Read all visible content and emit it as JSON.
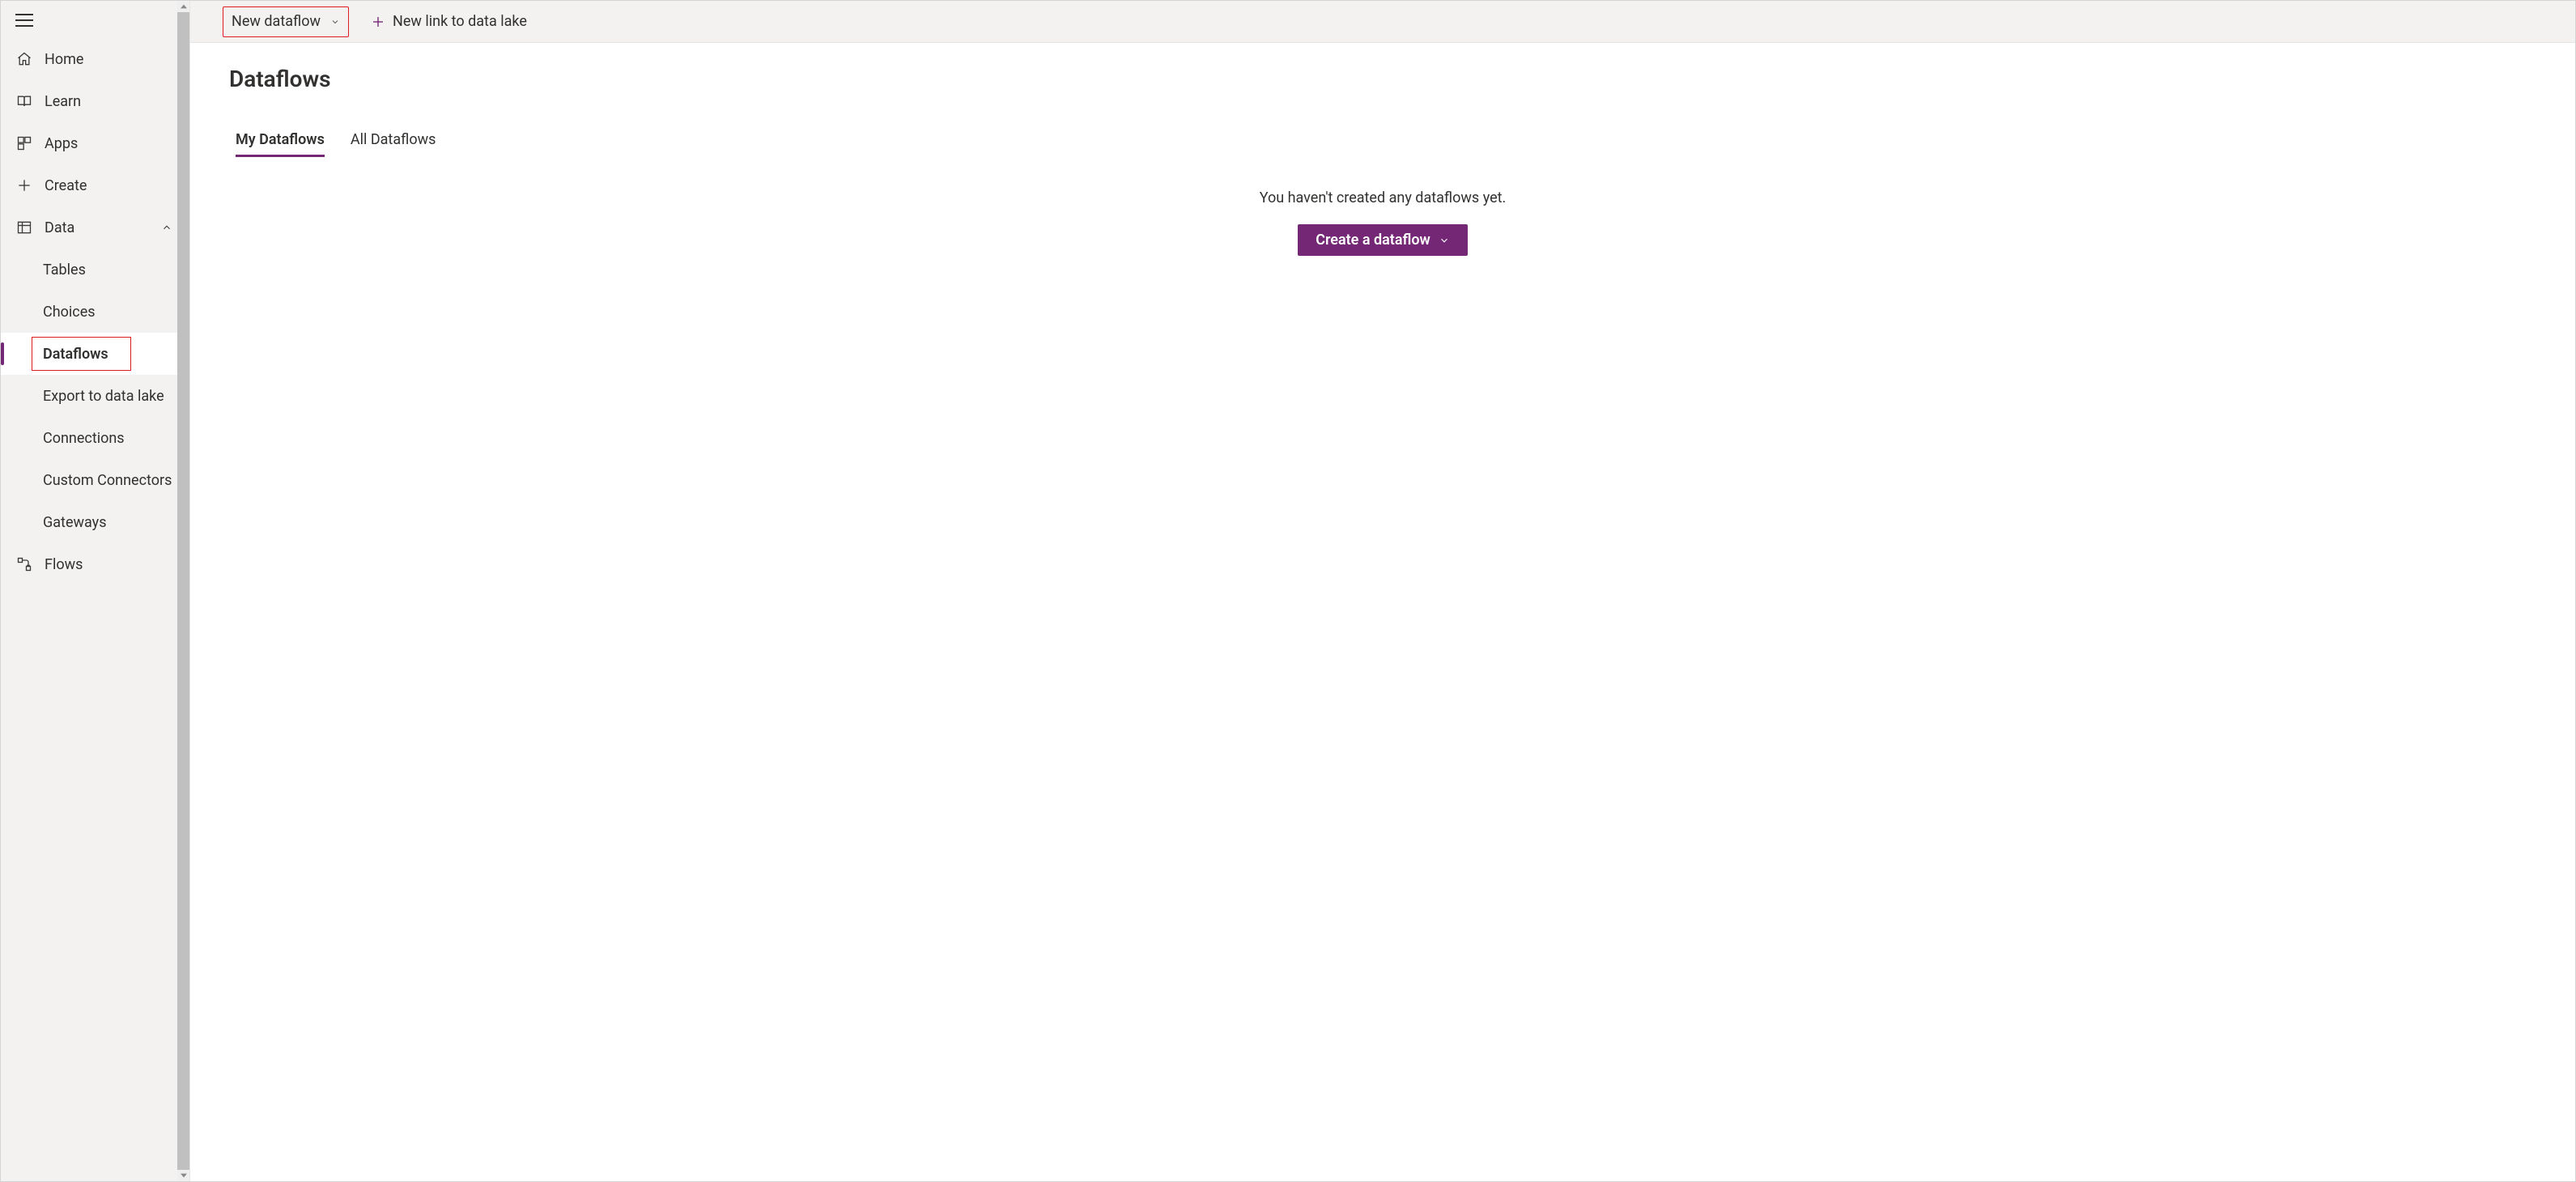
{
  "colors": {
    "accent": "#742774",
    "highlight_border": "#e11b22",
    "sidebar_bg": "#f3f2f1"
  },
  "sidebar": {
    "items": [
      {
        "icon": "home-icon",
        "label": "Home",
        "active": false
      },
      {
        "icon": "learn-icon",
        "label": "Learn",
        "active": false
      },
      {
        "icon": "apps-icon",
        "label": "Apps",
        "active": false
      },
      {
        "icon": "create-icon",
        "label": "Create",
        "active": false
      },
      {
        "icon": "data-icon",
        "label": "Data",
        "active": false,
        "expanded": true,
        "children": [
          {
            "label": "Tables",
            "active": false
          },
          {
            "label": "Choices",
            "active": false
          },
          {
            "label": "Dataflows",
            "active": true,
            "highlighted": true
          },
          {
            "label": "Export to data lake",
            "active": false
          },
          {
            "label": "Connections",
            "active": false
          },
          {
            "label": "Custom Connectors",
            "active": false
          },
          {
            "label": "Gateways",
            "active": false
          }
        ]
      },
      {
        "icon": "flows-icon",
        "label": "Flows",
        "active": false
      }
    ]
  },
  "command_bar": {
    "new_dataflow_label": "New dataflow",
    "new_link_label": "New link to data lake"
  },
  "page": {
    "title": "Dataflows",
    "tabs": [
      {
        "label": "My Dataflows",
        "active": true
      },
      {
        "label": "All Dataflows",
        "active": false
      }
    ],
    "empty_message": "You haven't created any dataflows yet.",
    "cta_label": "Create a dataflow"
  }
}
